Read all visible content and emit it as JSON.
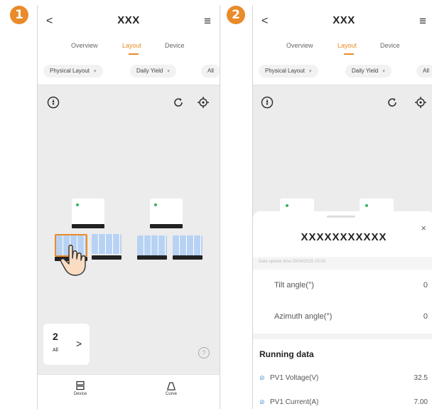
{
  "steps": [
    "1",
    "2"
  ],
  "screen1": {
    "back": "<",
    "title": "XXX",
    "menu": "≡",
    "tabs": [
      "Overview",
      "Layout",
      "Device"
    ],
    "filters": [
      "Physical Layout",
      "Daily Yield",
      "All"
    ],
    "summary": {
      "count": "2",
      "label": "All",
      "arrow": ">"
    },
    "help": "?",
    "nav": [
      {
        "label": "Device"
      },
      {
        "label": "Curve"
      }
    ]
  },
  "screen2": {
    "back": "<",
    "title": "XXX",
    "menu": "≡",
    "tabs": [
      "Overview",
      "Layout",
      "Device"
    ],
    "filters": [
      "Physical Layout",
      "Daily Yield",
      "All"
    ],
    "sheet": {
      "title": "XXXXXXXXXXX",
      "close": "×",
      "update_time": "Data update time:29/04/2025 15:05",
      "rows": [
        {
          "label": "Tilt angle(°)",
          "value": "0"
        },
        {
          "label": "Azimuth angle(°)",
          "value": "0"
        }
      ],
      "section_title": "Running data",
      "data_rows": [
        {
          "label": "PV1 Voltage(V)",
          "value": "32.5"
        },
        {
          "label": "PV1 Current(A)",
          "value": "7.00"
        }
      ]
    }
  },
  "colors": {
    "accent": "#e98b2a",
    "panel": "#b8d2f3",
    "online": "#33b45b"
  }
}
